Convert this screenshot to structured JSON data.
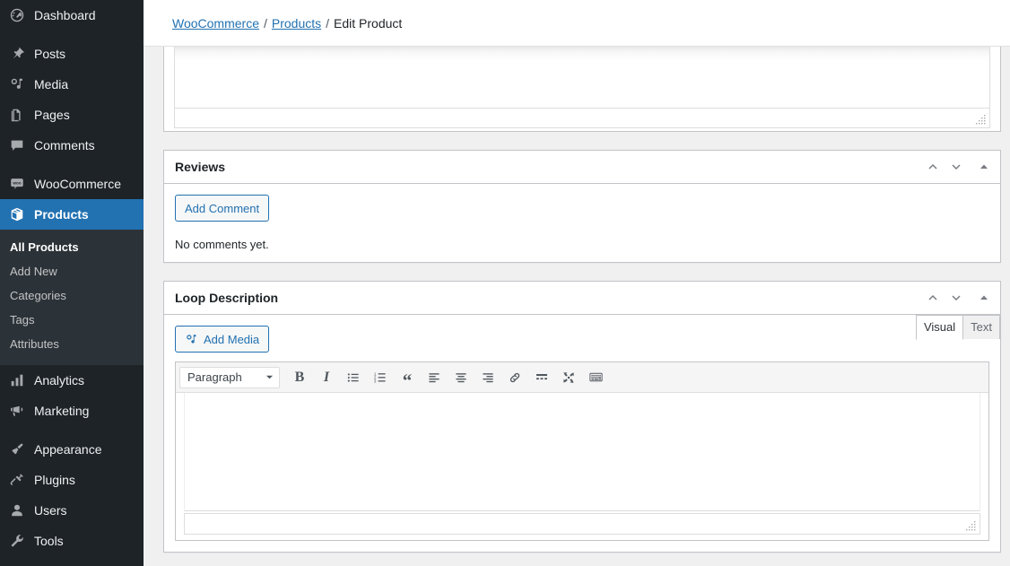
{
  "sidebar": {
    "items": [
      {
        "label": "Dashboard",
        "icon": "dashboard-icon",
        "name": "dashboard",
        "current": false,
        "sep_after": true
      },
      {
        "label": "Posts",
        "icon": "pin-icon",
        "name": "posts",
        "current": false,
        "sep_after": false
      },
      {
        "label": "Media",
        "icon": "media-icon",
        "name": "media",
        "current": false,
        "sep_after": false
      },
      {
        "label": "Pages",
        "icon": "pages-icon",
        "name": "pages",
        "current": false,
        "sep_after": false
      },
      {
        "label": "Comments",
        "icon": "comments-icon",
        "name": "comments",
        "current": false,
        "sep_after": true
      },
      {
        "label": "WooCommerce",
        "icon": "woocommerce-icon",
        "name": "woocommerce",
        "current": false,
        "sep_after": false
      },
      {
        "label": "Products",
        "icon": "products-icon",
        "name": "products",
        "current": true,
        "sep_after": false
      }
    ],
    "submenu": [
      {
        "label": "All Products",
        "name": "all-products",
        "current": true
      },
      {
        "label": "Add New",
        "name": "add-new",
        "current": false
      },
      {
        "label": "Categories",
        "name": "categories",
        "current": false
      },
      {
        "label": "Tags",
        "name": "tags",
        "current": false
      },
      {
        "label": "Attributes",
        "name": "attributes",
        "current": false
      }
    ],
    "items_after": [
      {
        "label": "Analytics",
        "icon": "analytics-icon",
        "name": "analytics",
        "current": false,
        "sep_after": false
      },
      {
        "label": "Marketing",
        "icon": "marketing-icon",
        "name": "marketing",
        "current": false,
        "sep_after": true
      },
      {
        "label": "Appearance",
        "icon": "appearance-icon",
        "name": "appearance",
        "current": false,
        "sep_after": false
      },
      {
        "label": "Plugins",
        "icon": "plugins-icon",
        "name": "plugins",
        "current": false,
        "sep_after": false
      },
      {
        "label": "Users",
        "icon": "users-icon",
        "name": "users",
        "current": false,
        "sep_after": false
      },
      {
        "label": "Tools",
        "icon": "tools-icon",
        "name": "tools",
        "current": false,
        "sep_after": false
      }
    ],
    "colors": {
      "background": "#1d2327",
      "submenu_background": "#2c3338",
      "current": "#2271b1"
    }
  },
  "breadcrumb": {
    "items": [
      {
        "label": "WooCommerce",
        "link": true
      },
      {
        "label": "Products",
        "link": true
      },
      {
        "label": "Edit Product",
        "link": false
      }
    ],
    "separator": "/"
  },
  "panels": {
    "reviews": {
      "title": "Reviews",
      "add_comment_label": "Add Comment",
      "empty_text": "No comments yet."
    },
    "loop_description": {
      "title": "Loop Description",
      "add_media_label": "Add Media",
      "tabs": [
        {
          "label": "Visual",
          "active": true
        },
        {
          "label": "Text",
          "active": false
        }
      ],
      "toolbar": {
        "format_select": "Paragraph",
        "buttons": [
          "bold-icon",
          "italic-icon",
          "bulleted-list-icon",
          "numbered-list-icon",
          "blockquote-icon",
          "align-left-icon",
          "align-center-icon",
          "align-right-icon",
          "link-icon",
          "read-more-icon",
          "fullscreen-icon",
          "keyboard-shortcuts-icon"
        ]
      },
      "content": ""
    },
    "header_controls": [
      {
        "name": "move-up",
        "icon": "chevron-up-icon"
      },
      {
        "name": "move-down",
        "icon": "chevron-down-icon"
      },
      {
        "name": "toggle-panel",
        "icon": "triangle-up-icon"
      }
    ]
  },
  "colors": {
    "accent": "#2271b1",
    "content_background": "#f0f0f1",
    "panel_border": "#c3c4c7",
    "text": "#1d2327"
  }
}
